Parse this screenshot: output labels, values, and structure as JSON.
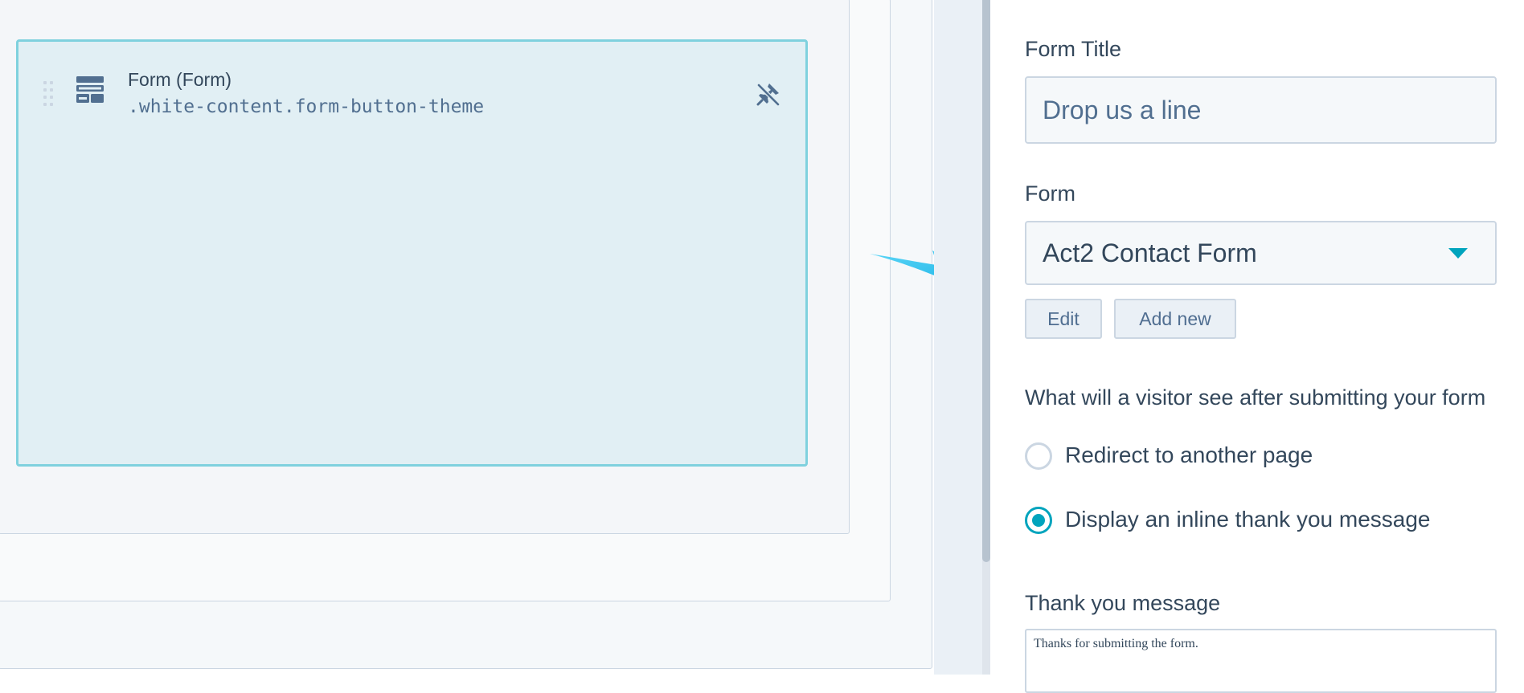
{
  "module": {
    "title": "Form (Form)",
    "class_name": ".white-content.form-button-theme",
    "icon": "form-icon",
    "pin_icon": "unpin-icon"
  },
  "sidebar": {
    "form_title": {
      "label": "Form Title",
      "value": "Drop us a line"
    },
    "form": {
      "label": "Form",
      "selected": "Act2 Contact Form",
      "edit_label": "Edit",
      "add_new_label": "Add new"
    },
    "after_submit": {
      "question": "What will a visitor see after submitting your form",
      "options": [
        {
          "label": "Redirect to another page",
          "selected": false
        },
        {
          "label": "Display an inline thank you message",
          "selected": true
        }
      ]
    },
    "thank_you": {
      "label": "Thank you message",
      "value": "Thanks for submitting the form."
    }
  },
  "colors": {
    "accent": "#00a4bd",
    "module_bg": "#e1eff4",
    "module_border": "#7fd1de",
    "arrow": "#2ec4f0"
  }
}
